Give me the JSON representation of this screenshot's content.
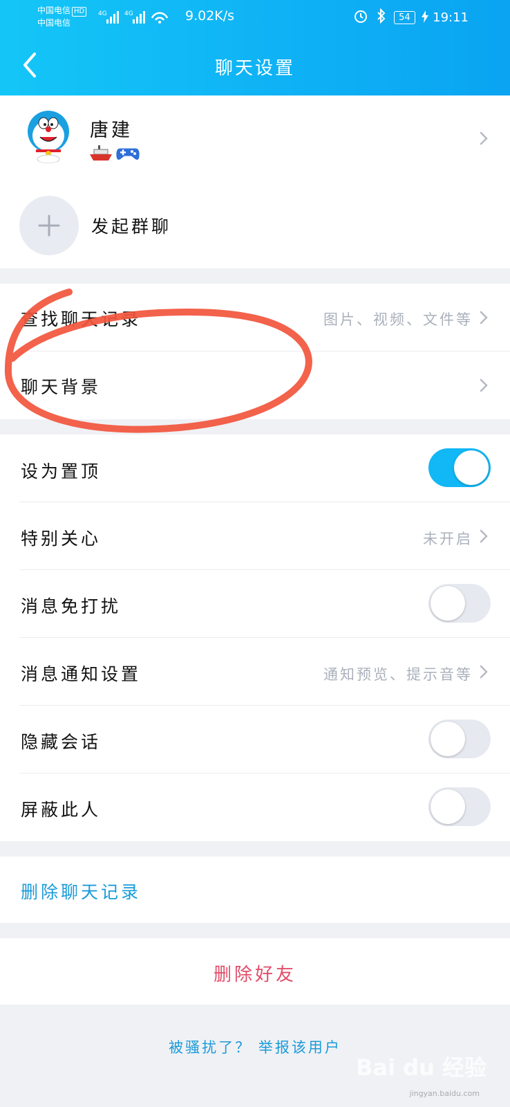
{
  "status_bar": {
    "carrier1": "中国电信",
    "hd": "HD",
    "carrier2": "中国电信",
    "net1": "4G",
    "net2": "4G",
    "speed": "9.02K/s",
    "battery": "54",
    "time": "19:11"
  },
  "header": {
    "title": "聊天设置",
    "back_icon": "chevron-left-icon"
  },
  "profile": {
    "name": "唐建",
    "badges": [
      "ship-icon",
      "gamepad-icon"
    ]
  },
  "group_chat": {
    "label": "发起群聊"
  },
  "section1": {
    "search_history": {
      "label": "查找聊天记录",
      "value": "图片、视频、文件等"
    },
    "chat_background": {
      "label": "聊天背景"
    }
  },
  "section2": {
    "pin": {
      "label": "设为置顶",
      "on": true
    },
    "special_care": {
      "label": "特别关心",
      "value": "未开启"
    },
    "dnd": {
      "label": "消息免打扰",
      "on": false
    },
    "notify_settings": {
      "label": "消息通知设置",
      "value": "通知预览、提示音等"
    },
    "hide_session": {
      "label": "隐藏会话",
      "on": false
    },
    "block": {
      "label": "屏蔽此人",
      "on": false
    }
  },
  "clear_history": {
    "label": "删除聊天记录"
  },
  "delete_friend": {
    "label": "删除好友"
  },
  "report": {
    "label": "被骚扰了？ 举报该用户"
  },
  "watermark": {
    "text": "Bai du 经验",
    "sub": "jingyan.baidu.com"
  },
  "colors": {
    "header_start": "#14c6f7",
    "header_end": "#0aa4f2",
    "toggle_on": "#12b7f5",
    "link_blue": "#1a9bd8",
    "danger": "#e14d6a",
    "annotation_red": "#f2553c"
  }
}
